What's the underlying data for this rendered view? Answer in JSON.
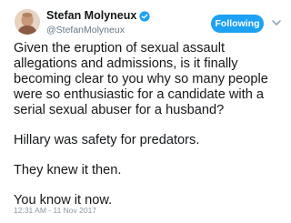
{
  "author": {
    "display_name": "Stefan Molyneux",
    "handle": "@StefanMolyneux",
    "verified": true
  },
  "actions": {
    "follow_label": "Following",
    "caret_icon": "chevron-down-icon"
  },
  "tweet": {
    "lines": [
      "Given the eruption of sexual assault",
      "allegations and admissions, is it finally",
      "becoming clear to you why so many people",
      "were so enthusiastic for a candidate with a",
      "serial sexual abuser for a husband?"
    ],
    "para2": "Hillary was safety for predators.",
    "para3": "They knew it then.",
    "para4": "You know it now.",
    "timestamp": "12:31 AM - 11 Nov 2017"
  },
  "colors": {
    "accent": "#1da1f2",
    "text": "#14171a",
    "muted": "#657786"
  }
}
